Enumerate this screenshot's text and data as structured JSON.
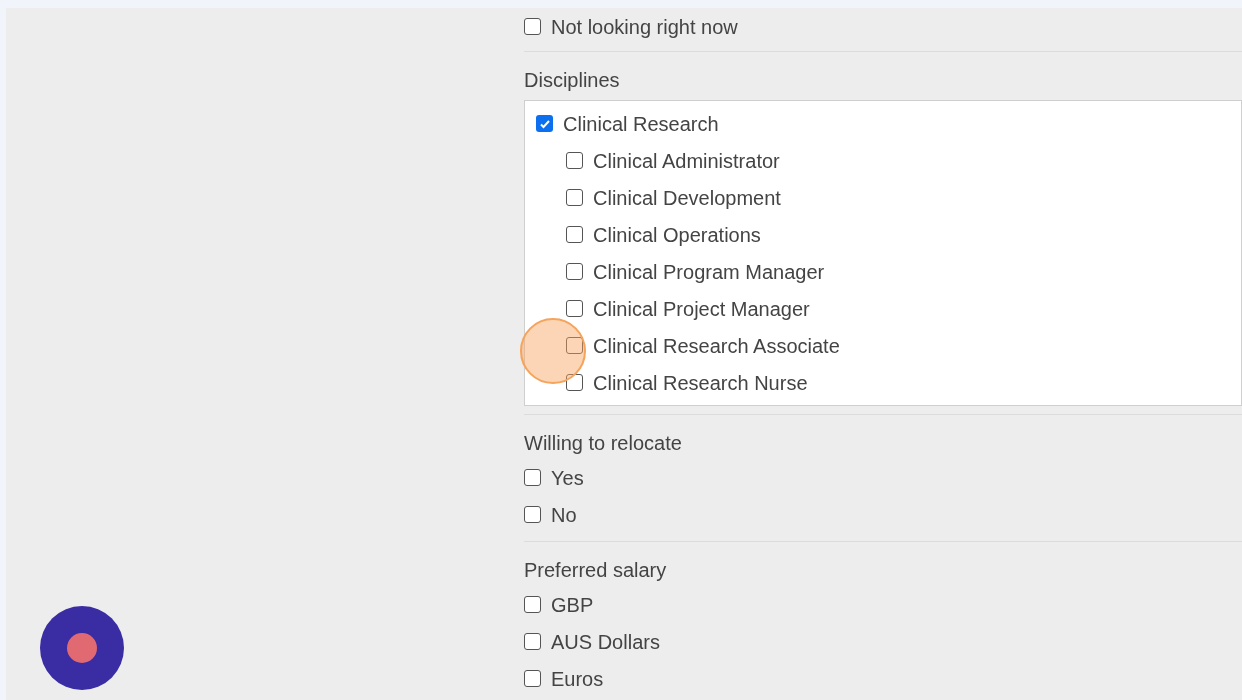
{
  "sections": [
    {
      "kind": "plain",
      "options": [
        {
          "label": "Not looking right now",
          "checked": false
        }
      ]
    },
    {
      "kind": "scroll_box",
      "title": "Disciplines",
      "options": [
        {
          "label": "Clinical Research",
          "checked": true,
          "children": [
            {
              "label": "Clinical Administrator",
              "checked": false
            },
            {
              "label": "Clinical Development",
              "checked": false
            },
            {
              "label": "Clinical Operations",
              "checked": false
            },
            {
              "label": "Clinical Program Manager",
              "checked": false
            },
            {
              "label": "Clinical Project Manager",
              "checked": false
            },
            {
              "label": "Clinical Research Associate",
              "checked": false
            },
            {
              "label": "Clinical Research Nurse",
              "checked": false
            }
          ]
        }
      ]
    },
    {
      "kind": "plain",
      "title": "Willing to relocate",
      "options": [
        {
          "label": "Yes",
          "checked": false
        },
        {
          "label": "No",
          "checked": false
        }
      ]
    },
    {
      "kind": "plain",
      "title": "Preferred salary",
      "options": [
        {
          "label": "GBP",
          "checked": false
        },
        {
          "label": "AUS Dollars",
          "checked": false
        },
        {
          "label": "Euros",
          "checked": false
        }
      ]
    }
  ]
}
